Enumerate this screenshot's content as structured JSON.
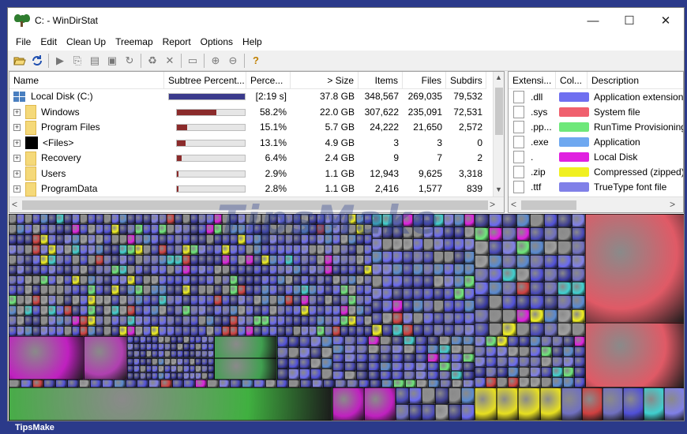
{
  "window": {
    "title": "C: - WinDirStat",
    "controls": {
      "minimize": "—",
      "maximize": "☐",
      "close": "✕"
    }
  },
  "menu": [
    "File",
    "Edit",
    "Clean Up",
    "Treemap",
    "Report",
    "Options",
    "Help"
  ],
  "toolbar": {
    "icons": [
      "open-icon",
      "refresh-icon",
      "play-icon",
      "copy-path-icon",
      "explorer-icon",
      "command-prompt-icon",
      "refresh-selected-icon",
      "recycle-icon",
      "delete-icon",
      "properties-icon",
      "zoom-in-icon",
      "zoom-out-icon",
      "help-icon"
    ]
  },
  "dir_list": {
    "columns": [
      "Name",
      "Subtree Percent...",
      "Perce...",
      "> Size",
      "Items",
      "Files",
      "Subdirs"
    ],
    "rows": [
      {
        "name": "Local Disk (C:)",
        "percent": "[2:19 s]",
        "subtree": 100,
        "size": "37.8 GB",
        "items": "348,567",
        "files": "269,035",
        "subdirs": "79,532",
        "icon": "disk"
      },
      {
        "name": "Windows",
        "percent": "58.2%",
        "subtree": 58.2,
        "size": "22.0 GB",
        "items": "307,622",
        "files": "235,091",
        "subdirs": "72,531",
        "icon": "folder"
      },
      {
        "name": "Program Files",
        "percent": "15.1%",
        "subtree": 15.1,
        "size": "5.7 GB",
        "items": "24,222",
        "files": "21,650",
        "subdirs": "2,572",
        "icon": "folder"
      },
      {
        "name": "<Files>",
        "percent": "13.1%",
        "subtree": 13.1,
        "size": "4.9 GB",
        "items": "3",
        "files": "3",
        "subdirs": "0",
        "icon": "files"
      },
      {
        "name": "Recovery",
        "percent": "6.4%",
        "subtree": 6.4,
        "size": "2.4 GB",
        "items": "9",
        "files": "7",
        "subdirs": "2",
        "icon": "folder"
      },
      {
        "name": "Users",
        "percent": "2.9%",
        "subtree": 2.9,
        "size": "1.1 GB",
        "items": "12,943",
        "files": "9,625",
        "subdirs": "3,318",
        "icon": "folder"
      },
      {
        "name": "ProgramData",
        "percent": "2.8%",
        "subtree": 2.8,
        "size": "1.1 GB",
        "items": "2,416",
        "files": "1,577",
        "subdirs": "839",
        "icon": "folder"
      }
    ]
  },
  "ext_list": {
    "columns": [
      "Extensi...",
      "Col...",
      "Description"
    ],
    "rows": [
      {
        "ext": ".dll",
        "color": "#6f6ff0",
        "desc": "Application extension"
      },
      {
        "ext": ".sys",
        "color": "#f0606e",
        "desc": "System file"
      },
      {
        "ext": ".pp...",
        "color": "#6ee87a",
        "desc": "RunTime Provisioning"
      },
      {
        "ext": ".exe",
        "color": "#6ea8f0",
        "desc": "Application"
      },
      {
        "ext": ".",
        "color": "#e020e0",
        "desc": "Local Disk"
      },
      {
        "ext": ".zip",
        "color": "#f0f020",
        "desc": "Compressed (zipped)"
      },
      {
        "ext": ".ttf",
        "color": "#8080e8",
        "desc": "TrueType font file"
      }
    ]
  },
  "watermark": "TipsMake",
  "footer": "TipsMake",
  "colors": {
    "bar_root": "#3a3a8c",
    "bar_child": "#8b2b2b",
    "frame": "#2b3a8a"
  }
}
